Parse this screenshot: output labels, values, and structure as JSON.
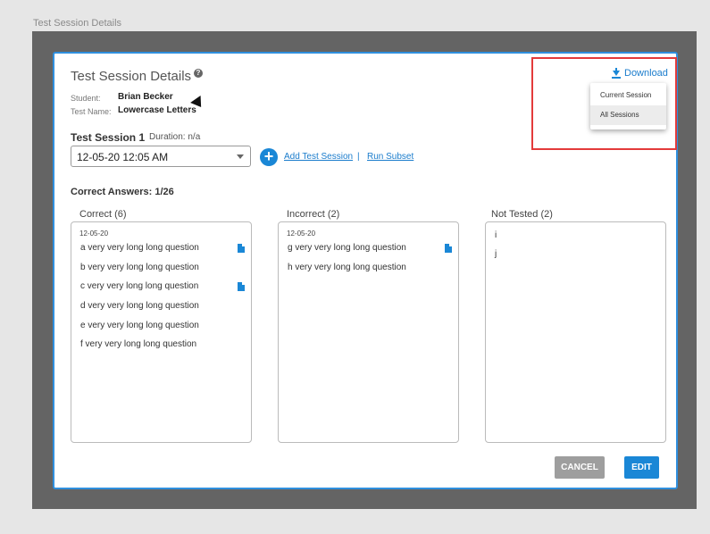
{
  "page": {
    "caption": "Test Session Details"
  },
  "modal": {
    "title": "Test Session Details",
    "help_icon": "help-icon",
    "student_label": "Student:",
    "student_value": "Brian Becker",
    "test_name_label": "Test Name:",
    "test_name_value": "Lowercase Letters",
    "session_title": "Test Session 1",
    "duration": "Duration: n/a",
    "date_value": "12-05-20  12:05 AM",
    "add_session_label": "Add Test Session",
    "separator": "|",
    "run_subset_label": "Run Subset",
    "correct_answers": "Correct Answers: 1/26",
    "columns": [
      {
        "title": "Correct (6)",
        "date": "12-05-20",
        "items": [
          {
            "text": "a very very long long question",
            "has_doc": true
          },
          {
            "text": "b very very long long question",
            "has_doc": false
          },
          {
            "text": "c very very long long question",
            "has_doc": true
          },
          {
            "text": "d very very long long question",
            "has_doc": false
          },
          {
            "text": "e very very long long question",
            "has_doc": false
          },
          {
            "text": "f very very long long question",
            "has_doc": false
          }
        ]
      },
      {
        "title": "Incorrect (2)",
        "date": "12-05-20",
        "items": [
          {
            "text": "g very very long long question",
            "has_doc": true
          },
          {
            "text": "h very very long long question",
            "has_doc": false
          }
        ]
      },
      {
        "title": "Not Tested (2)",
        "date": "",
        "items": [
          {
            "text": "i",
            "has_doc": false
          },
          {
            "text": "j",
            "has_doc": false
          }
        ]
      }
    ],
    "cancel_label": "CANCEL",
    "edit_label": "EDIT",
    "download_label": "Download",
    "download_menu": [
      "Current Session",
      "All Sessions"
    ]
  },
  "colors": {
    "accent": "#1a87d6",
    "cancel": "#9e9e9e",
    "highlight": "#e33a3a",
    "overlay": "#646464"
  }
}
